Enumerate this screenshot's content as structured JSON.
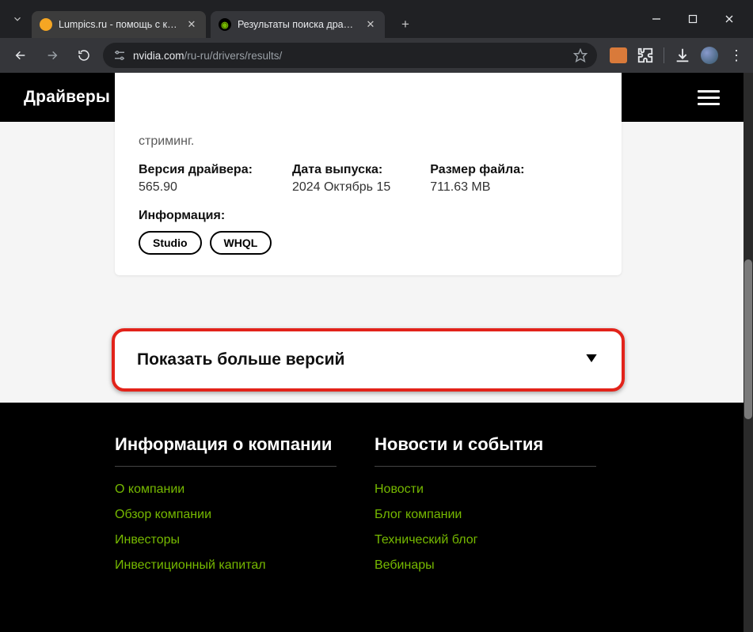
{
  "window": {
    "tab1_title": "Lumpics.ru - помощь с компь",
    "tab2_title": "Результаты поиска драйверов"
  },
  "toolbar": {
    "url_domain": "nvidia.com",
    "url_path": "/ru-ru/drivers/results/"
  },
  "topnav": {
    "brand": "Драйверы"
  },
  "driver": {
    "desc_fragment": "стриминг.",
    "version_label": "Версия драйвера:",
    "version_value": "565.90",
    "date_label": "Дата выпуска:",
    "date_value": "2024 Октябрь 15",
    "size_label": "Размер файла:",
    "size_value": "711.63 MB",
    "info_label": "Информация:",
    "pill_1": "Studio",
    "pill_2": "WHQL"
  },
  "showmore": {
    "label": "Показать больше версий"
  },
  "footer": {
    "col1_heading": "Информация о компании",
    "col2_heading": "Новости и события",
    "col1_links": {
      "l1": "О компании",
      "l2": "Обзор компании",
      "l3": "Инвесторы",
      "l4": "Инвестиционный капитал"
    },
    "col2_links": {
      "l1": "Новости",
      "l2": "Блог компании",
      "l3": "Технический блог",
      "l4": "Вебинары"
    }
  }
}
